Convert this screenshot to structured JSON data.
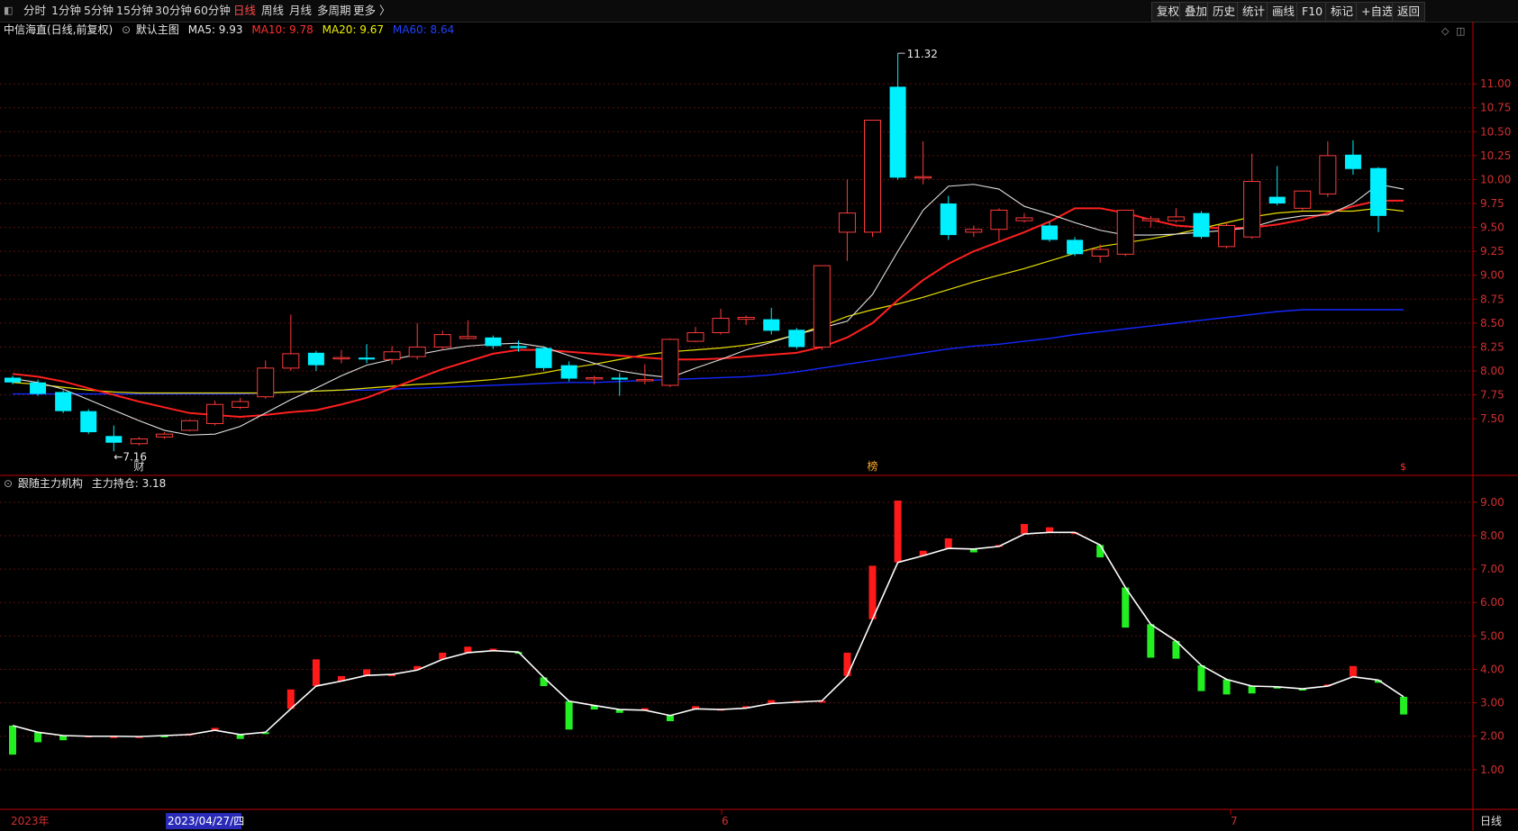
{
  "toolbar": {
    "periods": [
      "分时",
      "1分钟",
      "5分钟",
      "15分钟",
      "30分钟",
      "60分钟",
      "日线",
      "周线",
      "月线",
      "多周期",
      "更多 〉"
    ],
    "active": "日线",
    "right_buttons": [
      "复权",
      "叠加",
      "历史",
      "统计",
      "画线",
      "F10",
      "标记",
      "+自选",
      "返回"
    ]
  },
  "main_header": {
    "stock": "中信海直(日线,前复权)",
    "template": "默认主图",
    "ma5": "MA5: 9.93",
    "ma10": "MA10: 9.78",
    "ma20": "MA20: 9.67",
    "ma60": "MA60: 8.64"
  },
  "sub_header": {
    "name": "跟随主力机构",
    "value": "主力持仓: 3.18"
  },
  "colors": {
    "up": "#ff3b3b",
    "down": "#00f0ff",
    "ma5": "#e0e0e0",
    "ma10": "#ff2020",
    "ma20": "#e8e000",
    "ma60": "#1428ff",
    "hold_up": "#ff1a1a",
    "hold_down": "#22ee22",
    "hold_line": "#ffffff",
    "grid": "#5a1010",
    "axis": "#c00000"
  },
  "annotations": {
    "high": "11.32",
    "low": "7.16",
    "marker_cai": "财",
    "marker_bang": "榜",
    "marker_s": "$"
  },
  "bottom_axis": {
    "year": "2023年",
    "cursor_date": "2023/04/27/四",
    "month6": "6",
    "month7": "7",
    "period_label": "日线"
  },
  "chart_data": [
    {
      "type": "candlestick",
      "price_ticks": [
        "11.00",
        "10.75",
        "10.50",
        "10.25",
        "10.00",
        "9.75",
        "9.50",
        "9.25",
        "9.00",
        "8.75",
        "8.50",
        "8.25",
        "8.00",
        "7.75",
        "7.50"
      ],
      "ylim": [
        7.05,
        11.5
      ],
      "candles": [
        [
          7.93,
          7.88,
          7.95,
          7.86
        ],
        [
          7.88,
          7.76,
          7.91,
          7.74
        ],
        [
          7.78,
          7.58,
          7.8,
          7.56
        ],
        [
          7.58,
          7.36,
          7.6,
          7.34
        ],
        [
          7.32,
          7.25,
          7.43,
          7.16
        ],
        [
          7.24,
          7.29,
          7.31,
          7.22
        ],
        [
          7.31,
          7.34,
          7.36,
          7.29
        ],
        [
          7.38,
          7.48,
          7.49,
          7.37
        ],
        [
          7.45,
          7.65,
          7.69,
          7.43
        ],
        [
          7.62,
          7.68,
          7.72,
          7.6
        ],
        [
          7.73,
          8.03,
          8.11,
          7.71
        ],
        [
          8.03,
          8.18,
          8.59,
          8.0
        ],
        [
          8.19,
          8.06,
          8.21,
          8.0
        ],
        [
          8.14,
          8.14,
          8.22,
          8.08
        ],
        [
          8.14,
          8.12,
          8.28,
          8.08
        ],
        [
          8.12,
          8.2,
          8.26,
          8.07
        ],
        [
          8.15,
          8.25,
          8.5,
          8.12
        ],
        [
          8.25,
          8.38,
          8.42,
          8.22
        ],
        [
          8.34,
          8.36,
          8.53,
          8.33
        ],
        [
          8.35,
          8.26,
          8.37,
          8.23
        ],
        [
          8.26,
          8.24,
          8.32,
          8.2
        ],
        [
          8.24,
          8.03,
          8.26,
          8.0
        ],
        [
          8.06,
          7.92,
          8.1,
          7.89
        ],
        [
          7.92,
          7.93,
          7.95,
          7.86
        ],
        [
          7.93,
          7.91,
          7.98,
          7.74
        ],
        [
          7.9,
          7.91,
          8.07,
          7.86
        ],
        [
          7.85,
          8.33,
          8.34,
          7.83
        ],
        [
          8.31,
          8.4,
          8.46,
          8.3
        ],
        [
          8.4,
          8.55,
          8.65,
          8.38
        ],
        [
          8.54,
          8.56,
          8.58,
          8.48
        ],
        [
          8.54,
          8.42,
          8.66,
          8.38
        ],
        [
          8.43,
          8.25,
          8.45,
          8.23
        ],
        [
          8.25,
          9.1,
          9.1,
          8.22
        ],
        [
          9.45,
          9.65,
          10.0,
          9.15
        ],
        [
          9.45,
          10.62,
          10.62,
          9.4
        ],
        [
          10.97,
          10.02,
          11.32,
          10.0
        ],
        [
          10.02,
          10.03,
          10.4,
          9.95
        ],
        [
          9.75,
          9.42,
          9.83,
          9.37
        ],
        [
          9.45,
          9.48,
          9.52,
          9.4
        ],
        [
          9.48,
          9.68,
          9.7,
          9.36
        ],
        [
          9.57,
          9.6,
          9.65,
          9.55
        ],
        [
          9.52,
          9.37,
          9.56,
          9.35
        ],
        [
          9.37,
          9.22,
          9.4,
          9.2
        ],
        [
          9.2,
          9.27,
          9.32,
          9.13
        ],
        [
          9.22,
          9.68,
          9.68,
          9.2
        ],
        [
          9.57,
          9.59,
          9.62,
          9.5
        ],
        [
          9.57,
          9.61,
          9.7,
          9.55
        ],
        [
          9.65,
          9.4,
          9.67,
          9.38
        ],
        [
          9.3,
          9.52,
          9.55,
          9.28
        ],
        [
          9.4,
          9.98,
          10.27,
          9.38
        ],
        [
          9.82,
          9.75,
          10.14,
          9.73
        ],
        [
          9.7,
          9.88,
          9.88,
          9.68
        ],
        [
          9.85,
          10.25,
          10.4,
          9.82
        ],
        [
          10.26,
          10.11,
          10.41,
          10.05
        ],
        [
          10.12,
          9.62,
          10.13,
          9.45
        ]
      ],
      "ma5": [
        7.92,
        7.88,
        7.81,
        7.7,
        7.59,
        7.48,
        7.38,
        7.33,
        7.34,
        7.42,
        7.56,
        7.7,
        7.82,
        7.95,
        8.06,
        8.12,
        8.17,
        8.22,
        8.26,
        8.28,
        8.29,
        8.25,
        8.16,
        8.08,
        8.0,
        7.96,
        7.93,
        8.03,
        8.12,
        8.22,
        8.3,
        8.38,
        8.45,
        8.52,
        8.8,
        9.25,
        9.68,
        9.93,
        9.95,
        9.9,
        9.72,
        9.64,
        9.55,
        9.47,
        9.42,
        9.42,
        9.43,
        9.45,
        9.47,
        9.5,
        9.58,
        9.62,
        9.63,
        9.75,
        9.95,
        9.9
      ],
      "ma10": [
        7.97,
        7.94,
        7.89,
        7.82,
        7.75,
        7.68,
        7.62,
        7.56,
        7.54,
        7.52,
        7.54,
        7.57,
        7.59,
        7.65,
        7.72,
        7.82,
        7.92,
        8.02,
        8.1,
        8.18,
        8.22,
        8.22,
        8.2,
        8.18,
        8.16,
        8.14,
        8.12,
        8.12,
        8.13,
        8.15,
        8.17,
        8.19,
        8.25,
        8.35,
        8.5,
        8.74,
        8.95,
        9.12,
        9.25,
        9.35,
        9.45,
        9.56,
        9.7,
        9.7,
        9.65,
        9.58,
        9.52,
        9.5,
        9.49,
        9.5,
        9.53,
        9.58,
        9.65,
        9.72,
        9.78,
        9.78
      ],
      "ma20": [
        7.88,
        7.86,
        7.83,
        7.8,
        7.78,
        7.77,
        7.77,
        7.77,
        7.77,
        7.77,
        7.77,
        7.78,
        7.79,
        7.8,
        7.82,
        7.84,
        7.86,
        7.87,
        7.89,
        7.91,
        7.94,
        7.98,
        8.03,
        8.07,
        8.12,
        8.17,
        8.2,
        8.22,
        8.24,
        8.27,
        8.31,
        8.38,
        8.47,
        8.57,
        8.64,
        8.7,
        8.77,
        8.85,
        8.93,
        9.0,
        9.07,
        9.15,
        9.23,
        9.3,
        9.34,
        9.38,
        9.43,
        9.49,
        9.55,
        9.61,
        9.65,
        9.67,
        9.67,
        9.67,
        9.7,
        9.67
      ],
      "ma60": [
        7.76,
        7.76,
        7.76,
        7.76,
        7.76,
        7.76,
        7.76,
        7.76,
        7.76,
        7.76,
        7.77,
        7.78,
        7.79,
        7.8,
        7.8,
        7.81,
        7.82,
        7.83,
        7.84,
        7.85,
        7.86,
        7.87,
        7.88,
        7.88,
        7.89,
        7.9,
        7.91,
        7.92,
        7.93,
        7.94,
        7.96,
        7.99,
        8.03,
        8.07,
        8.11,
        8.15,
        8.19,
        8.23,
        8.26,
        8.28,
        8.31,
        8.34,
        8.38,
        8.41,
        8.44,
        8.47,
        8.5,
        8.53,
        8.56,
        8.59,
        8.62,
        8.64,
        8.64,
        8.64,
        8.64,
        8.64
      ]
    },
    {
      "type": "bar+line",
      "name": "主力持仓",
      "y_ticks": [
        "9.00",
        "8.00",
        "7.00",
        "6.00",
        "5.00",
        "4.00",
        "3.00",
        "2.00",
        "1.00"
      ],
      "ylim": [
        0,
        9.4
      ],
      "line": [
        2.32,
        2.12,
        2.02,
        2.0,
        2.0,
        1.99,
        2.02,
        2.05,
        2.18,
        2.05,
        2.12,
        2.82,
        3.5,
        3.65,
        3.82,
        3.85,
        3.98,
        4.3,
        4.5,
        4.56,
        4.52,
        3.76,
        3.05,
        2.92,
        2.8,
        2.78,
        2.62,
        2.82,
        2.8,
        2.84,
        2.98,
        3.02,
        3.06,
        3.8,
        5.5,
        7.2,
        7.4,
        7.62,
        7.6,
        7.68,
        8.05,
        8.1,
        8.1,
        7.72,
        6.45,
        5.35,
        4.85,
        4.12,
        3.7,
        3.5,
        3.48,
        3.42,
        3.5,
        3.78,
        3.68,
        3.18
      ],
      "bars": [
        [
          2.32,
          1.45
        ],
        [
          2.12,
          1.82
        ],
        [
          2.02,
          1.88
        ],
        [
          2.0,
          2.02
        ],
        [
          2.0,
          2.0
        ],
        [
          1.99,
          2.0
        ],
        [
          2.02,
          2.0
        ],
        [
          2.05,
          2.08
        ],
        [
          2.18,
          2.25
        ],
        [
          2.05,
          1.92
        ],
        [
          2.12,
          2.1
        ],
        [
          2.82,
          3.4
        ],
        [
          3.5,
          4.3
        ],
        [
          3.65,
          3.8
        ],
        [
          3.82,
          4.0
        ],
        [
          3.85,
          3.85
        ],
        [
          3.98,
          4.1
        ],
        [
          4.3,
          4.5
        ],
        [
          4.5,
          4.68
        ],
        [
          4.56,
          4.62
        ],
        [
          4.52,
          4.5
        ],
        [
          3.76,
          3.5
        ],
        [
          3.05,
          2.2
        ],
        [
          2.92,
          2.8
        ],
        [
          2.8,
          2.7
        ],
        [
          2.78,
          2.84
        ],
        [
          2.62,
          2.45
        ],
        [
          2.82,
          2.9
        ],
        [
          2.8,
          2.82
        ],
        [
          2.84,
          2.9
        ],
        [
          2.98,
          3.08
        ],
        [
          3.02,
          3.06
        ],
        [
          3.06,
          3.06
        ],
        [
          3.8,
          4.5
        ],
        [
          5.5,
          7.1
        ],
        [
          7.2,
          9.05
        ],
        [
          7.4,
          7.55
        ],
        [
          7.62,
          7.92
        ],
        [
          7.6,
          7.5
        ],
        [
          7.68,
          7.72
        ],
        [
          8.05,
          8.35
        ],
        [
          8.1,
          8.25
        ],
        [
          8.1,
          8.1
        ],
        [
          7.72,
          7.35
        ],
        [
          6.45,
          5.25
        ],
        [
          5.35,
          4.35
        ],
        [
          4.85,
          4.32
        ],
        [
          4.12,
          3.35
        ],
        [
          3.7,
          3.25
        ],
        [
          3.5,
          3.28
        ],
        [
          3.48,
          3.45
        ],
        [
          3.42,
          3.38
        ],
        [
          3.5,
          3.55
        ],
        [
          3.78,
          4.1
        ],
        [
          3.68,
          3.6
        ],
        [
          3.18,
          2.65
        ]
      ]
    }
  ]
}
